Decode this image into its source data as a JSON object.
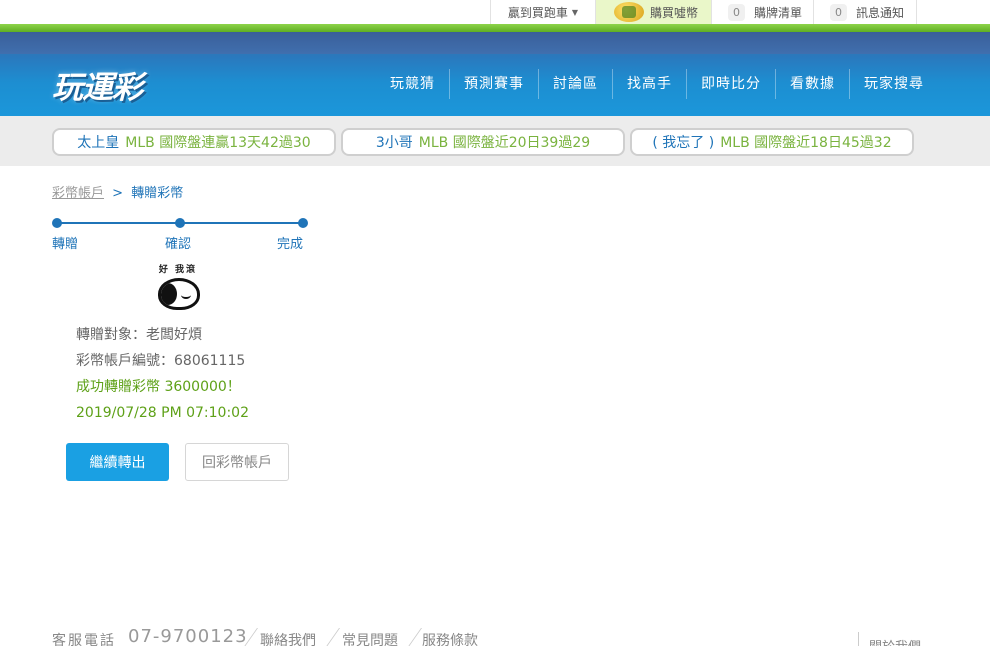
{
  "topbar": {
    "bet_cart": "贏到買跑車",
    "buy_coins": "購買噓幣",
    "purchase_list_count": "0",
    "purchase_list": "購牌清單",
    "notify_count": "0",
    "notify": "訊息通知"
  },
  "header": {
    "logo": "玩運彩",
    "nav": [
      "玩競猜",
      "預測賽事",
      "討論區",
      "找高手",
      "即時比分",
      "看數據",
      "玩家搜尋"
    ]
  },
  "ticker": [
    {
      "name": "太上皇",
      "text": "MLB 國際盤連贏13天42過30"
    },
    {
      "name": "3小哥",
      "text": "MLB 國際盤近20日39過29"
    },
    {
      "name": "( 我忘了 )",
      "text": "MLB 國際盤近18日45過32"
    }
  ],
  "breadcrumb": {
    "parent": "彩幣帳戶",
    "separator": ">",
    "current": "轉贈彩幣"
  },
  "steps": [
    "轉贈",
    "確認",
    "完成"
  ],
  "avatar": {
    "caption": "好 我滾"
  },
  "info": {
    "recipient": "轉贈對象：老闆好煩",
    "account": "彩幣帳戶編號：68061115",
    "success": "成功轉贈彩幣 3600000！",
    "timestamp": "2019/07/28 PM 07:10:02"
  },
  "buttons": {
    "continue": "繼續轉出",
    "back": "回彩幣帳戶"
  },
  "footer": {
    "service_label": "客服電話",
    "phone": "07-9700123",
    "contact": "聯絡我們",
    "faq": "常見問題",
    "terms": "服務條款",
    "about": "關於我們"
  },
  "colors": {
    "accent_blue": "#1f74b8",
    "button_blue": "#1aa0e3",
    "success_green": "#5ea118",
    "ticker_green": "#7ab33f"
  }
}
